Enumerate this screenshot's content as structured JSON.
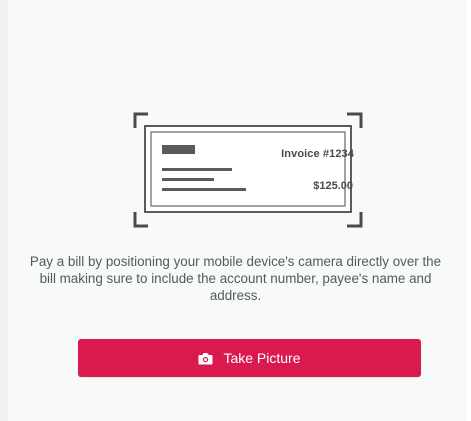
{
  "invoice": {
    "number_label": "Invoice #1234",
    "amount": "$125.00"
  },
  "instructions": {
    "text": "Pay a bill by positioning your mobile device's camera directly over the bill making sure to include the account number, payee's name and address."
  },
  "actions": {
    "take_picture_label": "Take Picture",
    "take_picture_icon": "camera-icon"
  },
  "colors": {
    "accent": "#da1a4e",
    "panel_background": "#f8f9f9",
    "text": "#555a5e",
    "illustration": "#4a4a4a"
  }
}
